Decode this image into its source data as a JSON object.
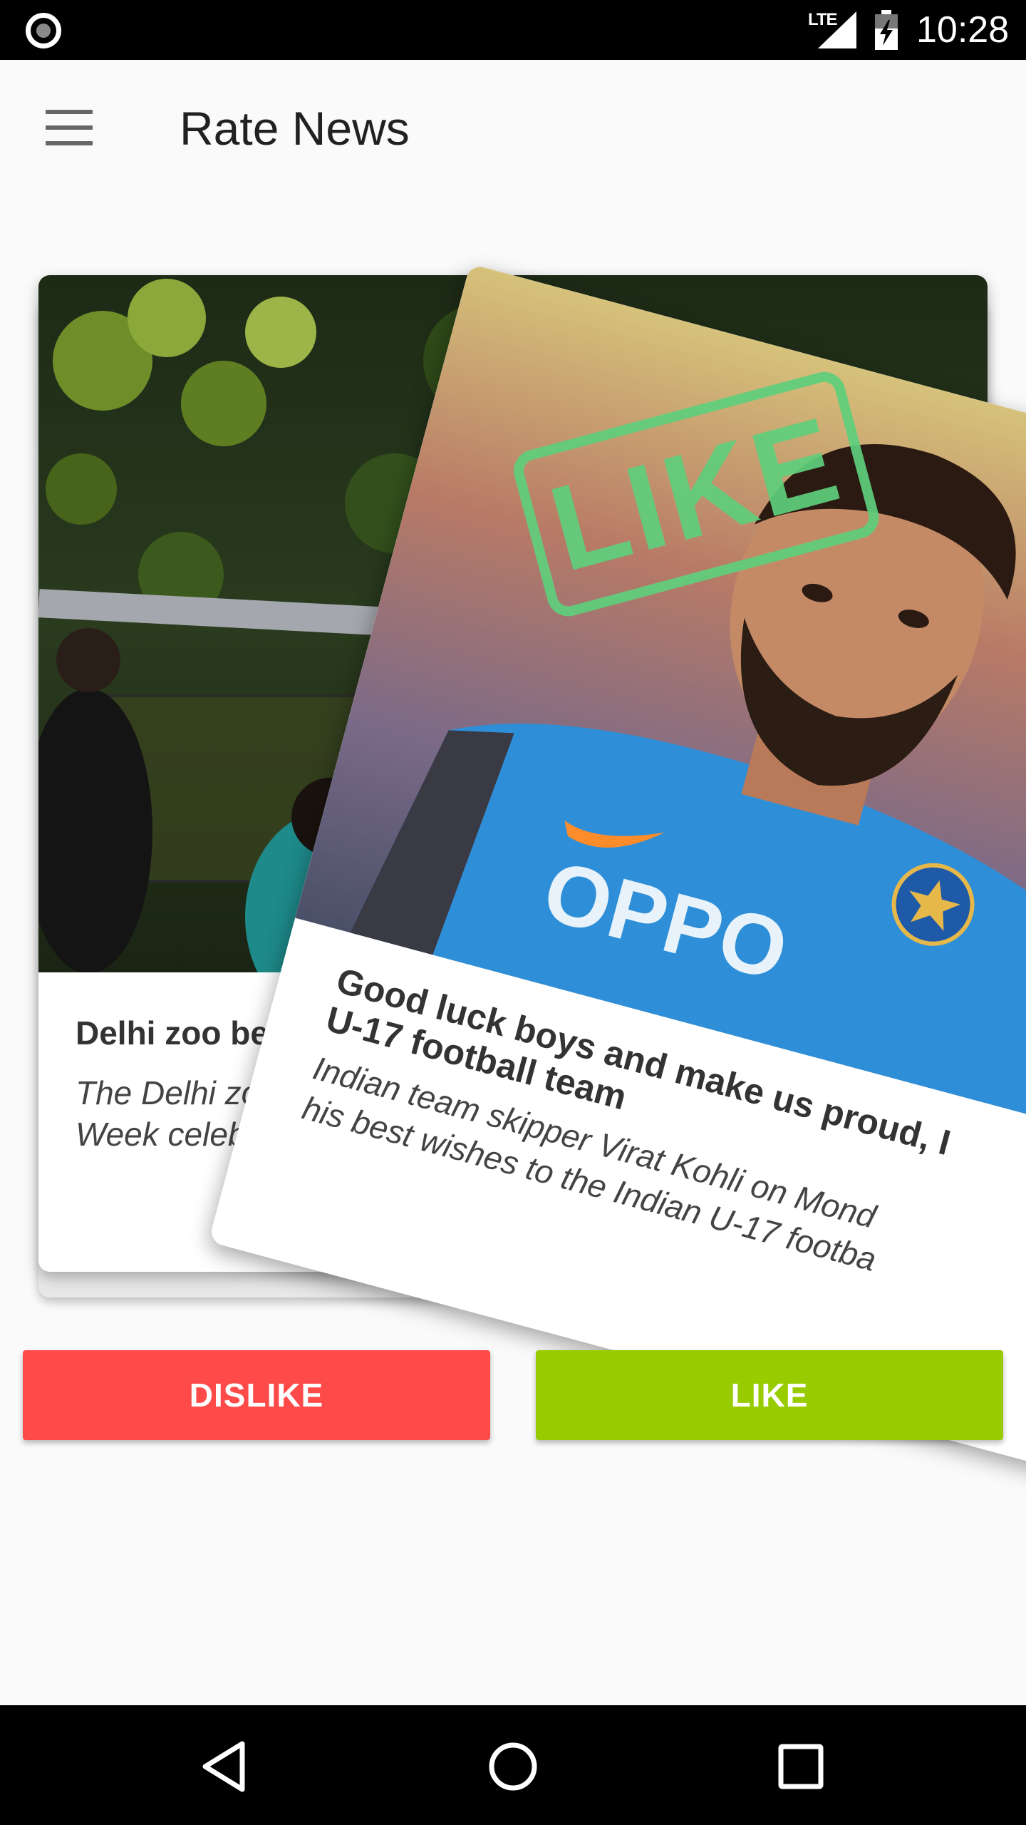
{
  "status_bar": {
    "network": "LTE",
    "time": "10:28",
    "icons": [
      "record-icon",
      "signal-icon",
      "battery-charging-icon"
    ]
  },
  "app_bar": {
    "title": "Rate News",
    "menu_icon": "hamburger-menu-icon"
  },
  "back_card": {
    "headline": "Delhi zoo begins Natio",
    "summary_line1": "The Delhi zoo on Sunc",
    "summary_line2": "Week celebrations, w"
  },
  "top_card": {
    "headline_line1": "Good luck boys and make us proud, I",
    "headline_line2": "U-17 football team",
    "summary_line1": "Indian team skipper Virat Kohli on Mond",
    "summary_line2": "his best wishes to the Indian U-17 footba",
    "stamp": "LIKE",
    "jersey_text": "OPPO"
  },
  "buttons": {
    "dislike": "DISLIKE",
    "like": "LIKE"
  },
  "colors": {
    "dislike": "#ff4a4a",
    "like": "#98cc00",
    "stamp": "#5fcf7c"
  },
  "nav_bar": {
    "icons": [
      "back-icon",
      "home-icon",
      "recents-icon"
    ]
  }
}
